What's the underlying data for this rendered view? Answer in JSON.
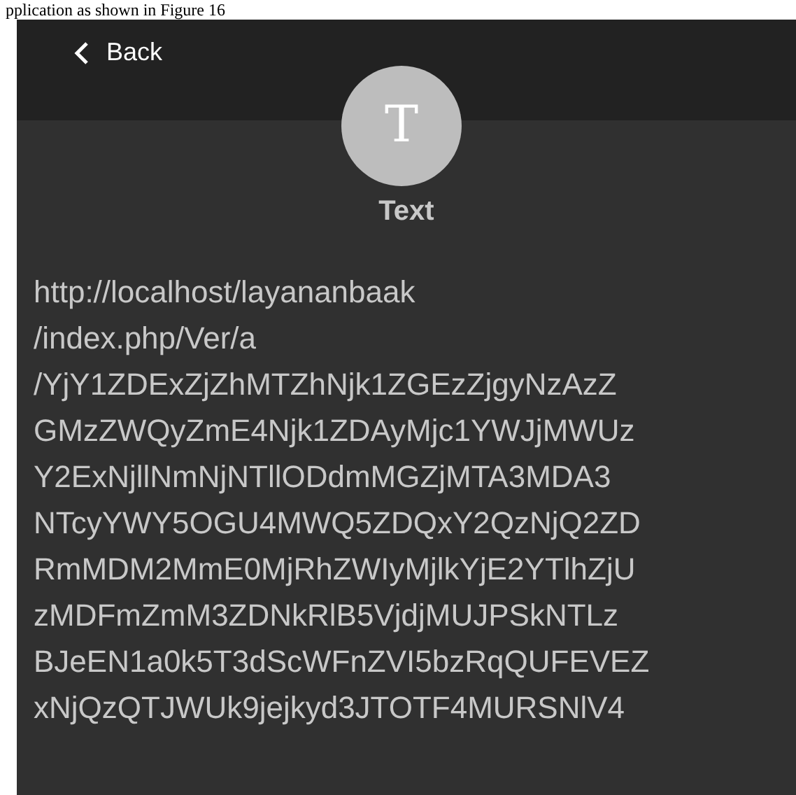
{
  "caption": "pplication as shown in Figure 16",
  "header": {
    "back_label": "Back"
  },
  "avatar": {
    "letter": "T"
  },
  "title": "Text",
  "content_lines": [
    "http://localhost/layananbaak",
    "/index.php/Ver/a",
    "/YjY1ZDExZjZhMTZhNjk1ZGEzZjgyNzAzZ",
    "GMzZWQyZmE4Njk1ZDAyMjc1YWJjMWUz",
    "Y2ExNjllNmNjNTllODdmMGZjMTA3MDA3",
    "NTcyYWY5OGU4MWQ5ZDQxY2QzNjQ2ZD",
    "RmMDM2MmE0MjRhZWIyMjlkYjE2YTlhZjU",
    "zMDFmZmM3ZDNkRlB5VjdjMUJPSkNTLz",
    "BJeEN1a0k5T3dScWFnZVI5bzRqQUFEVEZ",
    "xNjQzQTJWUk9jejkyd3JTOTF4MURSNlV4"
  ]
}
